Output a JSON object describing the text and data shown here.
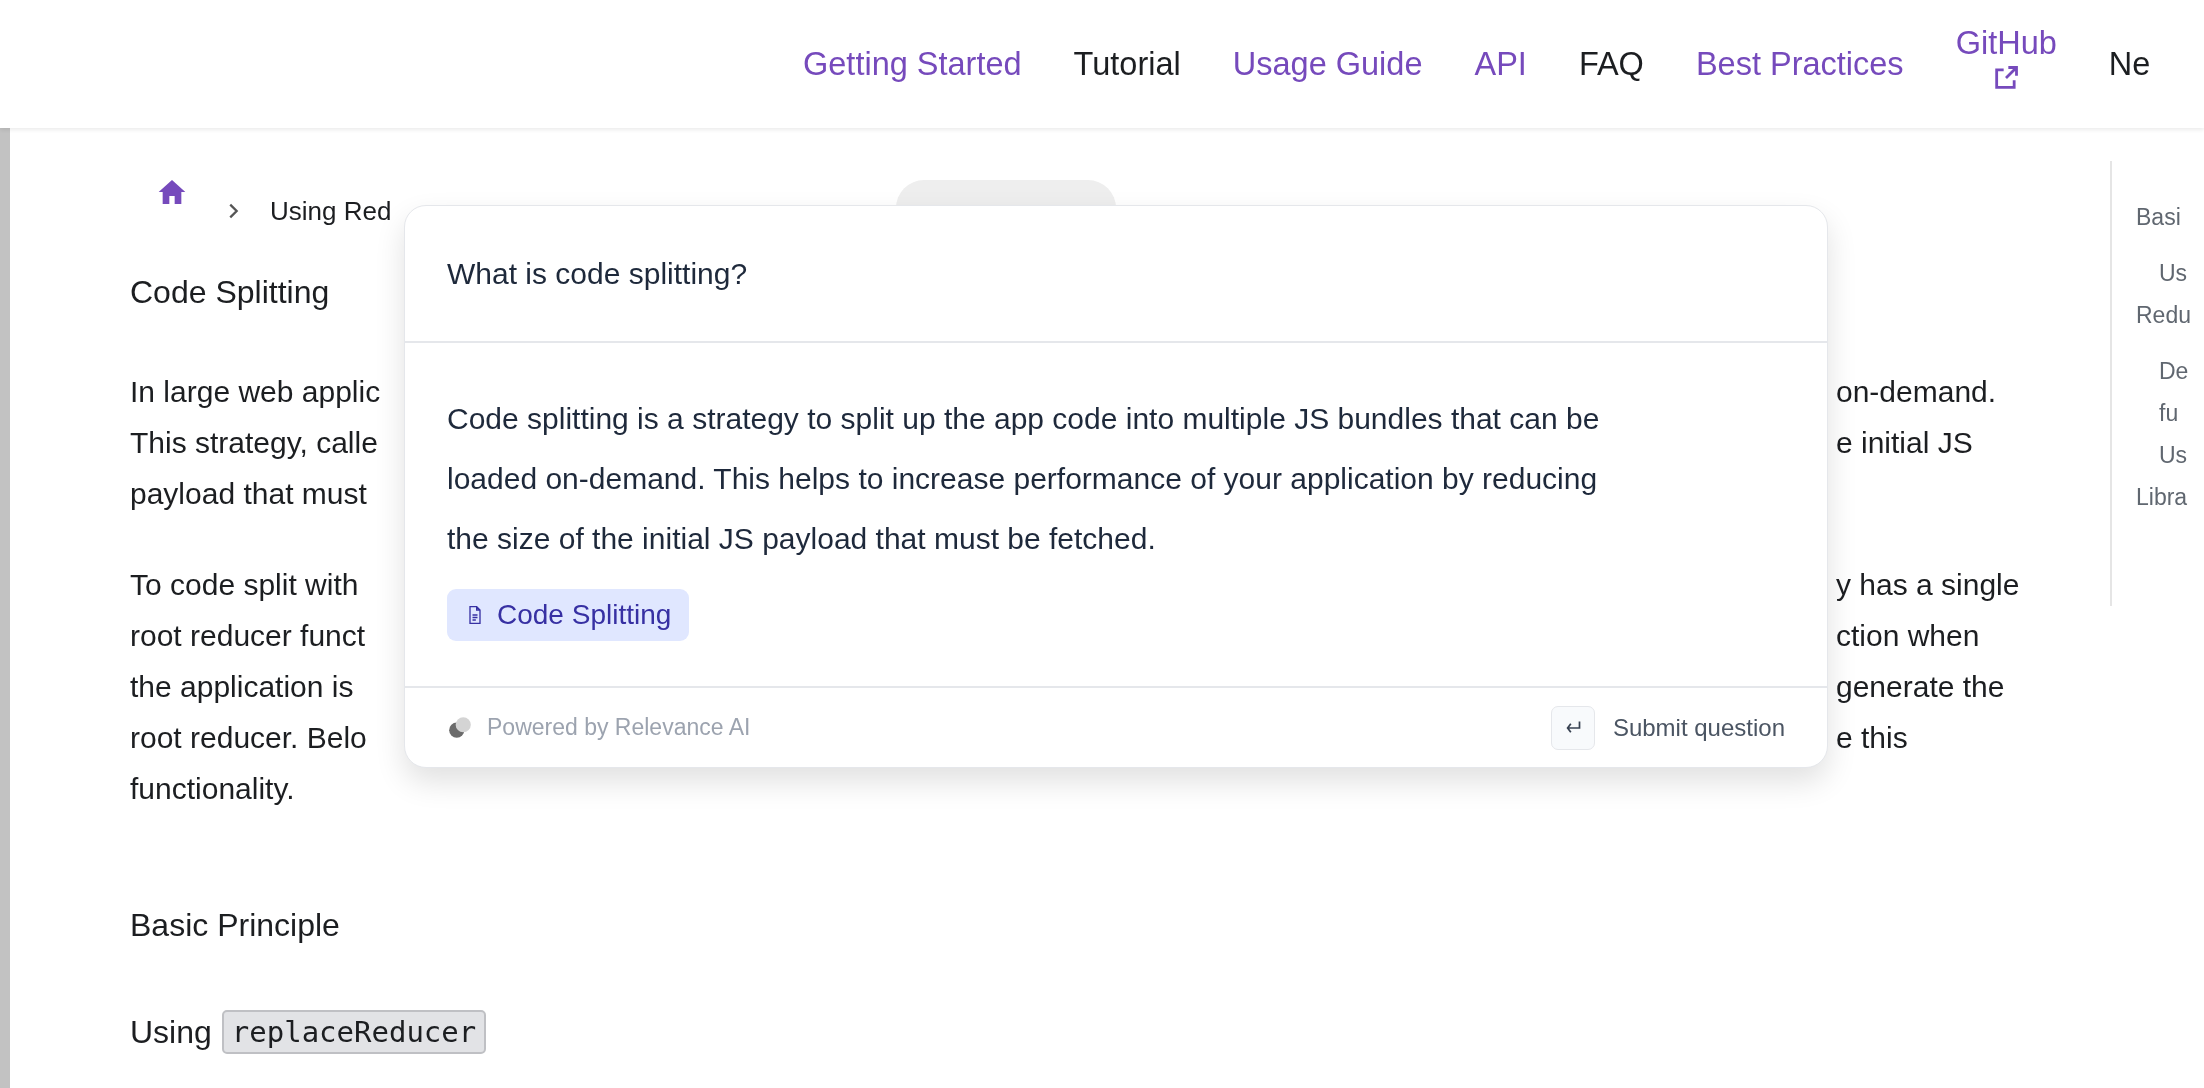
{
  "nav": {
    "items": [
      {
        "label": "Getting Started",
        "highlighted": true
      },
      {
        "label": "Tutorial",
        "highlighted": false
      },
      {
        "label": "Usage Guide",
        "highlighted": true
      },
      {
        "label": "API",
        "highlighted": true
      },
      {
        "label": "FAQ",
        "highlighted": false
      },
      {
        "label": "Best Practices",
        "highlighted": true
      },
      {
        "label": "GitHub",
        "highlighted": true,
        "external": true
      },
      {
        "label": "Ne",
        "highlighted": false
      }
    ]
  },
  "breadcrumb": {
    "items": [
      {
        "label": "Using Red"
      }
    ]
  },
  "article": {
    "title": "Code Splitting",
    "paragraphs": [
      {
        "lines": [
          {
            "left": "In large web applic",
            "right": "on-demand."
          },
          {
            "left": "This strategy, calle",
            "right": "e initial JS"
          },
          {
            "left": "payload that must"
          }
        ]
      },
      {
        "lines": [
          {
            "left": "To code split with",
            "right": "y has a single"
          },
          {
            "left": "root reducer funct",
            "right": "ction when"
          },
          {
            "left": "the application is",
            "right": "generate the"
          },
          {
            "left": "root reducer. Belo",
            "right": "e this"
          },
          {
            "left": "functionality."
          }
        ]
      }
    ],
    "section": "Basic Principle",
    "subsection": {
      "text": "Using",
      "code": "replaceReducer"
    }
  },
  "toc": {
    "items": [
      {
        "label": "Basi",
        "children": [
          {
            "label": "Us"
          }
        ]
      },
      {
        "label": "Redu",
        "children": [
          {
            "label": "De"
          },
          {
            "label": "fu"
          },
          {
            "label": "Us"
          }
        ]
      },
      {
        "label": "Libra"
      }
    ]
  },
  "assistant": {
    "question": "What is code splitting?",
    "answer": "Code splitting is a strategy to split up the app code into multiple JS bundles that can be loaded on-demand. This helps to increase performance of your application by reducing the size of the initial JS payload that must be fetched.",
    "sources": [
      "Code Splitting"
    ],
    "powered_by": "Powered by Relevance AI",
    "submit": "Submit question"
  }
}
